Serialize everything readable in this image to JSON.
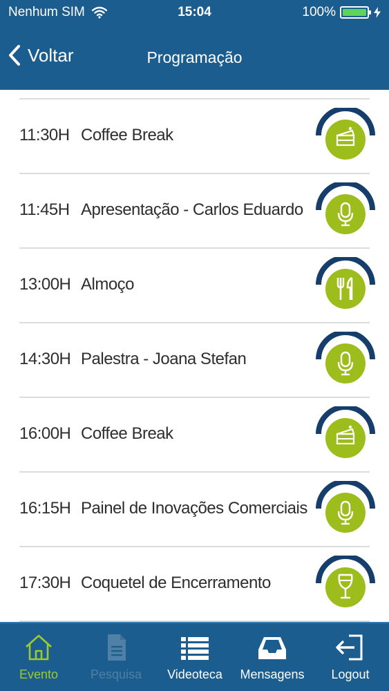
{
  "status_bar": {
    "carrier": "Nenhum SIM",
    "time": "15:04",
    "battery": "100%"
  },
  "nav": {
    "back_label": "Voltar",
    "title": "Programação"
  },
  "schedule": [
    {
      "time": "11:30H",
      "title": "Coffee Break",
      "icon": "cake-icon"
    },
    {
      "time": "11:45H",
      "title": "Apresentação - Carlos Eduardo",
      "icon": "microphone-icon"
    },
    {
      "time": "13:00H",
      "title": "Almoço",
      "icon": "fork-knife-icon"
    },
    {
      "time": "14:30H",
      "title": "Palestra - Joana Stefan",
      "icon": "microphone-icon"
    },
    {
      "time": "16:00H",
      "title": "Coffee Break",
      "icon": "cake-icon"
    },
    {
      "time": "16:15H",
      "title": "Painel de Inovações Comerciais",
      "icon": "microphone-icon"
    },
    {
      "time": "17:30H",
      "title": "Coquetel de Encerramento",
      "icon": "wine-glass-icon"
    }
  ],
  "tabbar": {
    "items": [
      {
        "label": "Evento",
        "icon": "home-icon",
        "state": "active"
      },
      {
        "label": "Pesquisa",
        "icon": "document-icon",
        "state": "disabled"
      },
      {
        "label": "Videoteca",
        "icon": "list-icon",
        "state": "normal"
      },
      {
        "label": "Mensagens",
        "icon": "inbox-icon",
        "state": "normal"
      },
      {
        "label": "Logout",
        "icon": "logout-icon",
        "state": "normal"
      }
    ]
  },
  "colors": {
    "header_blue": "#1c5d8f",
    "badge_green": "#9cbd1c",
    "badge_arc": "#153e6b",
    "active_green": "#9ccb2d"
  }
}
